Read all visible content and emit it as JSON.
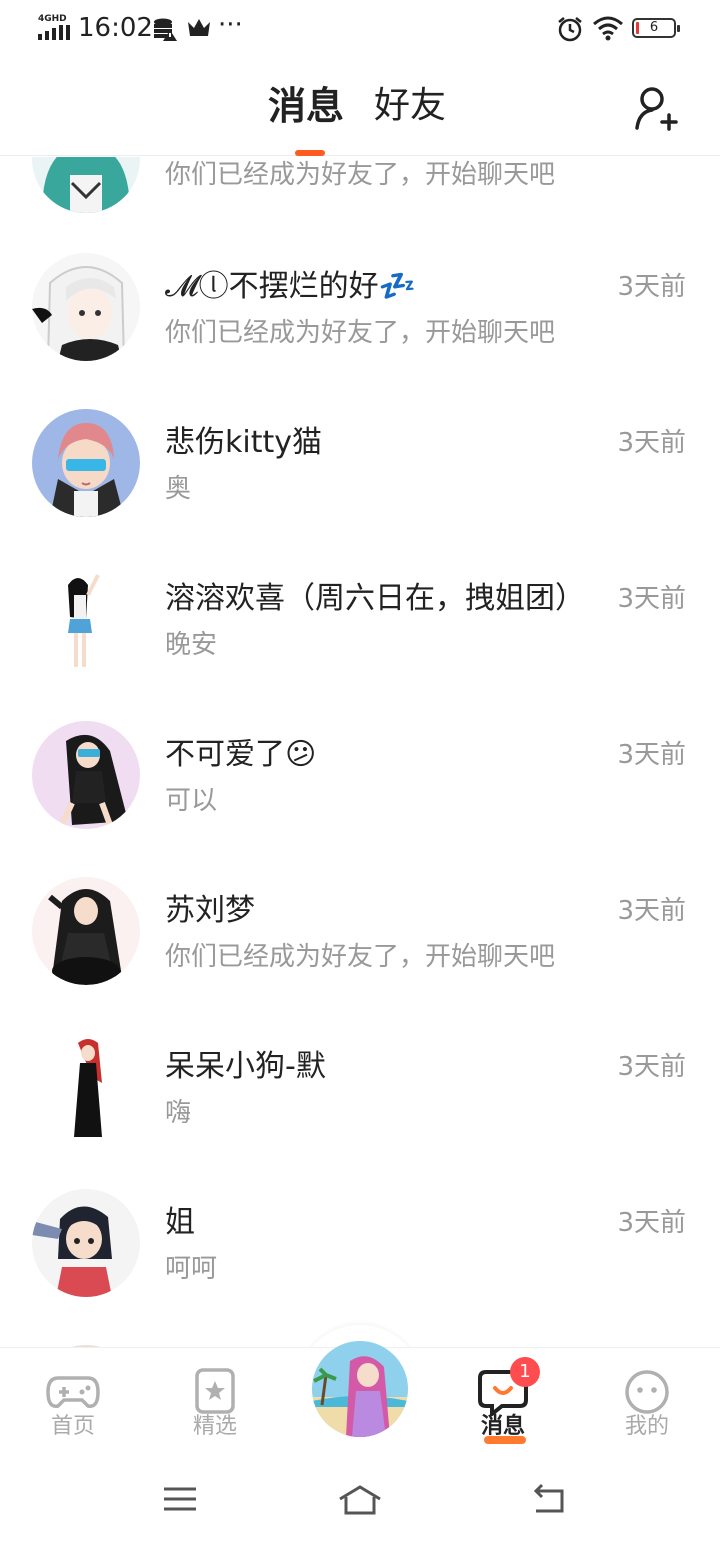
{
  "status_bar": {
    "network": "4GHD",
    "time": "16:02",
    "more": "···",
    "battery": "6"
  },
  "header": {
    "tabs": [
      {
        "label": "消息",
        "active": true
      },
      {
        "label": "好友",
        "active": false
      }
    ]
  },
  "messages": [
    {
      "name": "",
      "preview": "你们已经成为好友了，开始聊天吧",
      "time": ""
    },
    {
      "name": "𝓜ⓛ不摆烂的好💤",
      "preview": "你们已经成为好友了，开始聊天吧",
      "time": "3天前"
    },
    {
      "name": "悲伤kitty猫",
      "preview": "奥",
      "time": "3天前"
    },
    {
      "name": "溶溶欢喜（周六日在，拽姐团）",
      "preview": "晚安",
      "time": "3天前"
    },
    {
      "name": "不可爱了😕",
      "preview": "可以",
      "time": "3天前"
    },
    {
      "name": "苏刘梦",
      "preview": "你们已经成为好友了，开始聊天吧",
      "time": "3天前"
    },
    {
      "name": "呆呆小狗-默",
      "preview": "嗨",
      "time": "3天前"
    },
    {
      "name": "姐",
      "preview": "呵呵",
      "time": "3天前"
    }
  ],
  "bottom_nav": {
    "items": [
      {
        "label": "首页",
        "icon": "gamepad-icon"
      },
      {
        "label": "精选",
        "icon": "star-bookmark-icon"
      },
      {
        "label": "消息",
        "icon": "chat-bubble-icon",
        "badge": "1",
        "active": true
      },
      {
        "label": "我的",
        "icon": "face-icon"
      }
    ],
    "center_icon": "character-avatar"
  },
  "colors": {
    "accent": "#ff5a1f",
    "badge": "#ff4d4f",
    "text": "#222222",
    "muted": "#999999"
  }
}
